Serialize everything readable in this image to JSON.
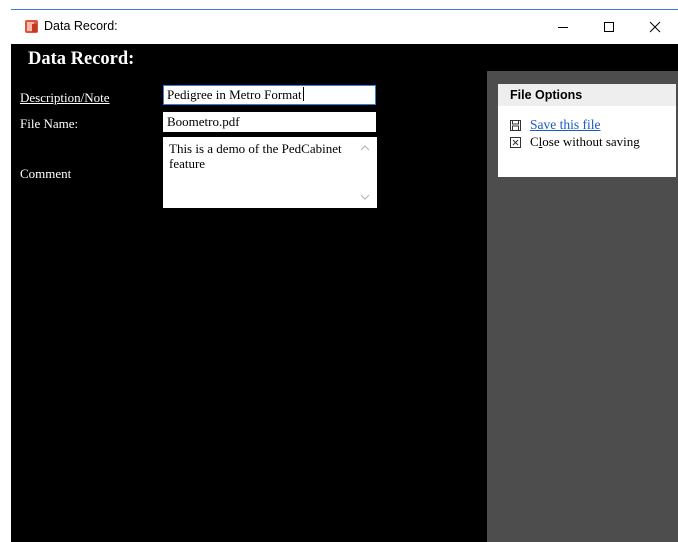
{
  "window": {
    "title": "Data Record:",
    "controls": {
      "minimize": "minimize",
      "maximize": "maximize",
      "close": "close"
    }
  },
  "heading": "Data Record:",
  "form": {
    "description_label": "Description/Note",
    "description_value": "Pedigree in Metro Format",
    "filename_label": "File Name:",
    "filename_value": "Boometro.pdf",
    "comment_label": "Comment",
    "comment_value": "This is a demo of the PedCabinet feature"
  },
  "file_options": {
    "title": "File Options",
    "save_label": "Save this file",
    "close_label_prefix": "C",
    "close_label_access": "l",
    "close_label_rest": "ose without saving"
  },
  "icons": {
    "app": "pedigree-app-icon",
    "save": "floppy-disk-icon",
    "close": "x-box-icon"
  },
  "colors": {
    "background": "#000000",
    "panel": "#4d4d4d",
    "link": "#1a5bbf",
    "focus_border": "#2f7fd7",
    "app_icon": "#e0533b"
  }
}
